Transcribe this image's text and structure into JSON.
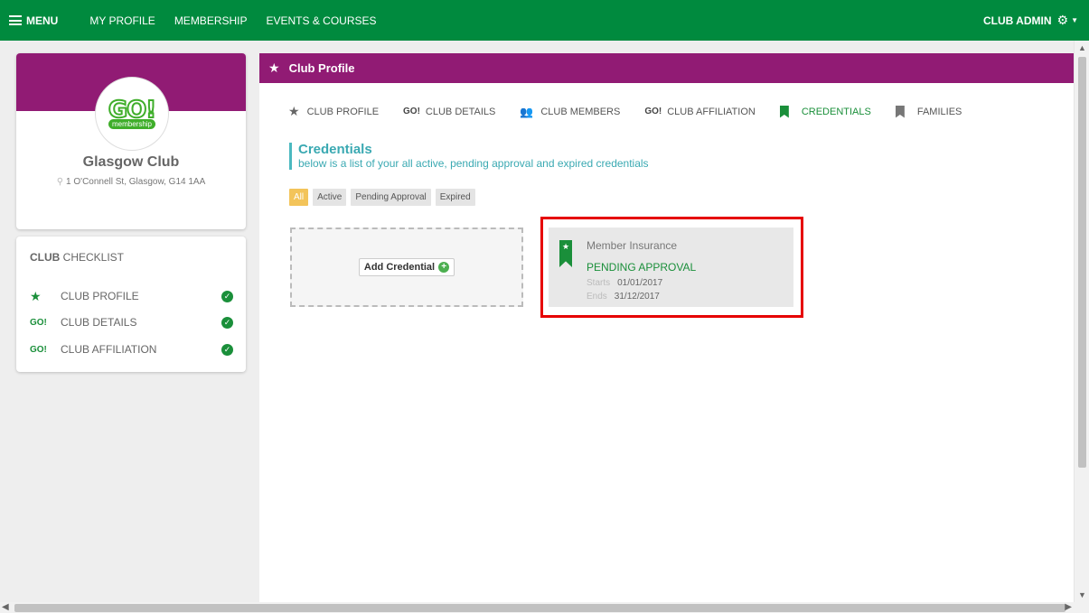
{
  "topnav": {
    "menu_label": "MENU",
    "links": [
      "MY PROFILE",
      "MEMBERSHIP",
      "EVENTS & COURSES"
    ],
    "user_label": "CLUB ADMIN"
  },
  "profile": {
    "logo_text": "GO!",
    "logo_sub": "membership",
    "club_name": "Glasgow Club",
    "address": "1 O'Connell St, Glasgow, G14 1AA"
  },
  "checklist": {
    "title_bold": "CLUB",
    "title_rest": " CHECKLIST",
    "items": [
      {
        "icon": "star-icon",
        "label": "CLUB PROFILE",
        "done": true
      },
      {
        "icon": "go-icon",
        "label": "CLUB DETAILS",
        "done": true
      },
      {
        "icon": "go-icon",
        "label": "CLUB AFFILIATION",
        "done": true
      }
    ]
  },
  "main": {
    "header_title": "Club Profile",
    "tabs": [
      {
        "icon": "star-icon",
        "label": "CLUB PROFILE"
      },
      {
        "icon": "go-icon",
        "label": "CLUB DETAILS"
      },
      {
        "icon": "users-icon",
        "label": "CLUB MEMBERS"
      },
      {
        "icon": "go-icon",
        "label": "CLUB AFFILIATION"
      },
      {
        "icon": "bookmark-icon",
        "label": "CREDENTIALS",
        "active": true
      },
      {
        "icon": "bookmark-icon",
        "label": "FAMILIES"
      }
    ],
    "section_title": "Credentials",
    "section_subtitle": "below is a list of your all active, pending approval and expired credentials",
    "filters": [
      "All",
      "Active",
      "Pending Approval",
      "Expired"
    ],
    "add_button_label": "Add Credential",
    "credential": {
      "name": "Member Insurance",
      "status": "PENDING APPROVAL",
      "starts_label": "Starts",
      "starts_value": "01/01/2017",
      "ends_label": "Ends",
      "ends_value": "31/12/2017"
    }
  },
  "colors": {
    "topbar": "#008a3e",
    "brand_purple": "#911b74",
    "accent_green": "#1a8f3a",
    "accent_teal": "#3aa9b2",
    "highlight_red": "#e60000",
    "filter_active": "#f3c45a"
  }
}
